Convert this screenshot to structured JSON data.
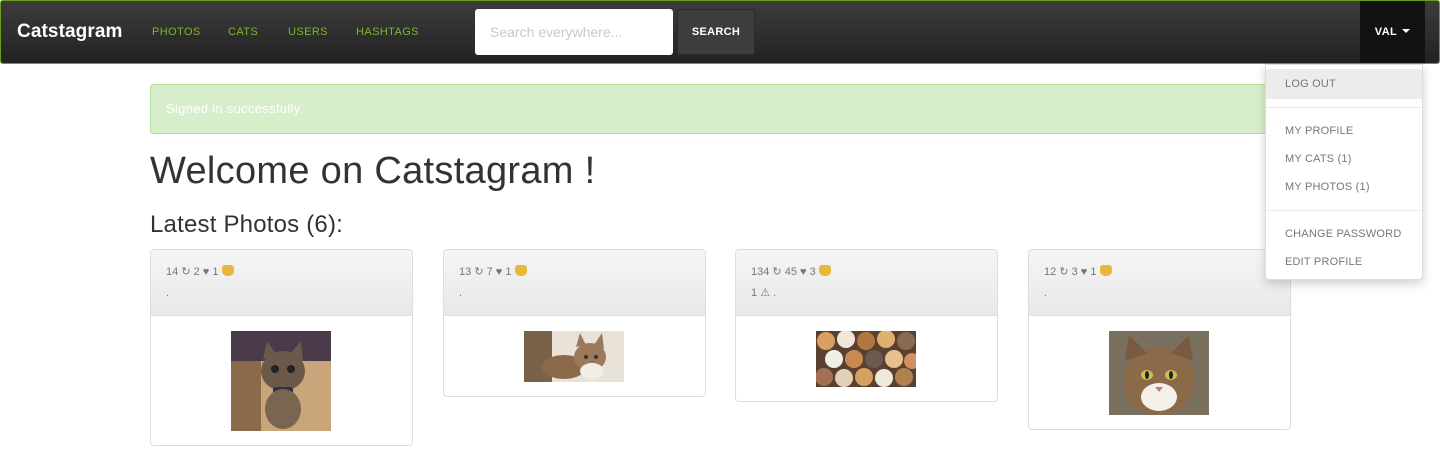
{
  "navbar": {
    "brand": "Catstagram",
    "links": [
      "PHOTOS",
      "CATS",
      "USERS",
      "HASHTAGS"
    ],
    "search_placeholder": "Search everywhere...",
    "search_button": "SEARCH",
    "user_label": "VAL"
  },
  "dropdown": {
    "logout": "LOG OUT",
    "my_profile": "MY PROFILE",
    "my_cats": "MY CATS (1)",
    "my_photos": "MY PHOTOS (1)",
    "change_password": "CHANGE PASSWORD",
    "edit_profile": "EDIT PROFILE"
  },
  "alert": "Signed in successfully.",
  "heading": "Welcome on Catstagram !",
  "subheading": "Latest Photos (6):",
  "photos": [
    {
      "views": "14",
      "reposts": "2",
      "likes": "1",
      "cats": "1",
      "warnings": "",
      "tags": "."
    },
    {
      "views": "13",
      "reposts": "7",
      "likes": "1",
      "cats": "1",
      "warnings": "",
      "tags": "."
    },
    {
      "views": "134",
      "reposts": "45",
      "likes": "3",
      "cats": "1",
      "warnings": "1",
      "tags": "."
    },
    {
      "views": "12",
      "reposts": "3",
      "likes": "1",
      "cats": "1",
      "warnings": "",
      "tags": "."
    }
  ],
  "icons": {
    "repost": "↻",
    "like": "♥",
    "warning": "⚠",
    "cat": "cat-face-icon"
  },
  "colors": {
    "nav_link": "#7db829",
    "alert_bg": "#d7eecb",
    "navbar_border": "#6a9c1f"
  }
}
